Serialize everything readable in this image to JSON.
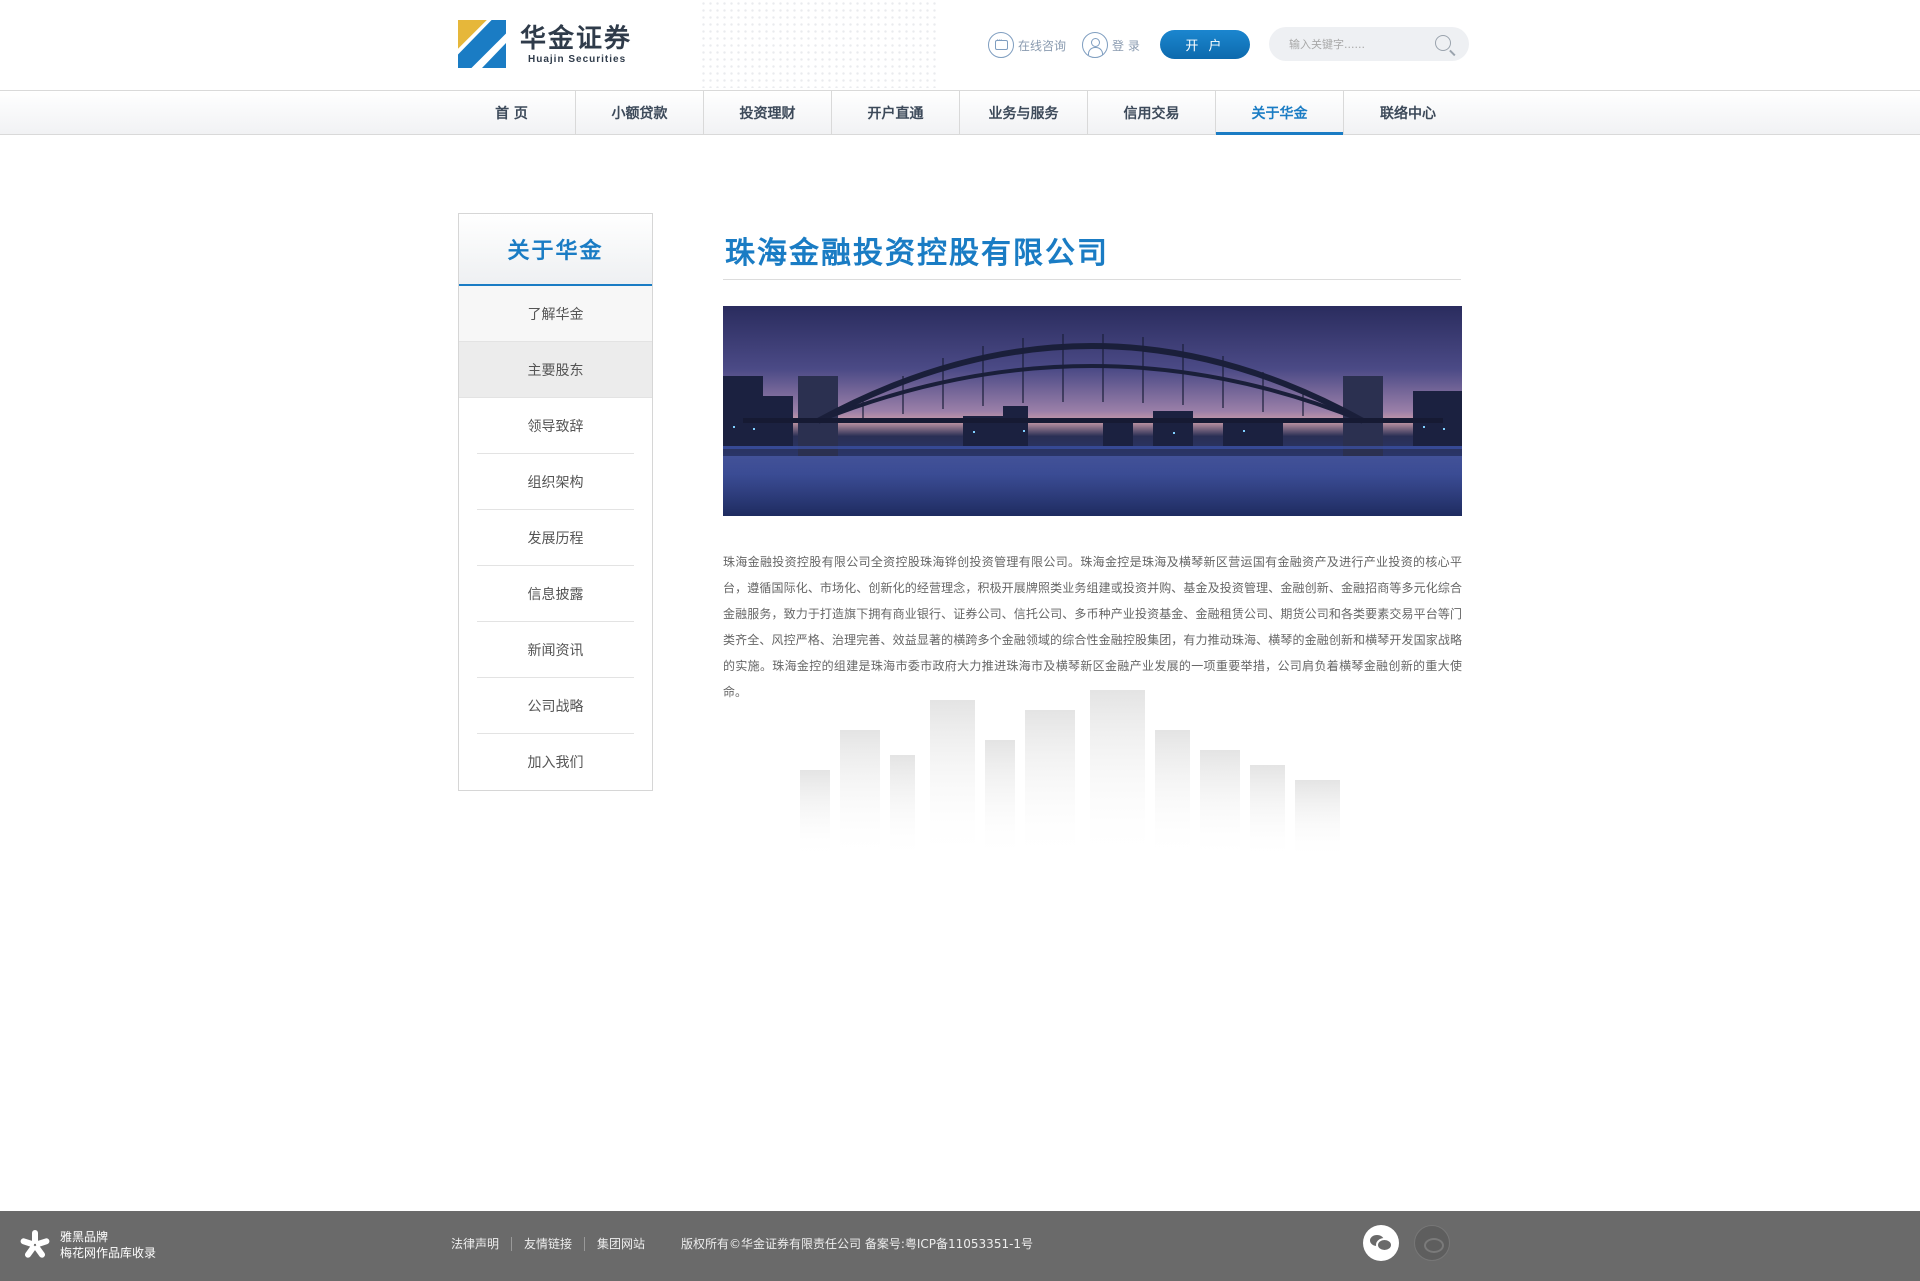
{
  "brand": {
    "name_cn": "华金证券",
    "name_en": "Huajin Securities"
  },
  "header": {
    "consult_label": "在线咨询",
    "login_label": "登 录",
    "open_account_label": "开 户",
    "search_placeholder": "输入关键字......"
  },
  "nav": {
    "items": [
      {
        "label": "首 页",
        "active": false
      },
      {
        "label": "小额贷款",
        "active": false
      },
      {
        "label": "投资理财",
        "active": false
      },
      {
        "label": "开户直通",
        "active": false
      },
      {
        "label": "业务与服务",
        "active": false
      },
      {
        "label": "信用交易",
        "active": false
      },
      {
        "label": "关于华金",
        "active": true
      },
      {
        "label": "联络中心",
        "active": false
      }
    ]
  },
  "sidebar": {
    "title": "关于华金",
    "items": [
      {
        "label": "了解华金"
      },
      {
        "label": "主要股东",
        "selected": true
      },
      {
        "label": "领导致辞"
      },
      {
        "label": "组织架构"
      },
      {
        "label": "发展历程"
      },
      {
        "label": "信息披露"
      },
      {
        "label": "新闻资讯"
      },
      {
        "label": "公司战略"
      },
      {
        "label": "加入我们"
      }
    ]
  },
  "main": {
    "title": "珠海金融投资控股有限公司",
    "image_icon": "harbour-bridge-night-photo",
    "body": "珠海金融投资控股有限公司全资控股珠海铧创投资管理有限公司。珠海金控是珠海及横琴新区营运国有金融资产及进行产业投资的核心平台，遵循国际化、市场化、创新化的经营理念，积极开展牌照类业务组建或投资并购、基金及投资管理、金融创新、金融招商等多元化综合金融服务，致力于打造旗下拥有商业银行、证券公司、信托公司、多币种产业投资基金、金融租赁公司、期货公司和各类要素交易平台等门类齐全、风控严格、治理完善、效益显著的横跨多个金融领域的综合性金融控股集团，有力推动珠海、横琴的金融创新和横琴开发国家战略的实施。珠海金控的组建是珠海市委市政府大力推进珠海市及横琴新区金融产业发展的一项重要举措，公司肩负着横琴金融创新的重大使命。"
  },
  "footer": {
    "brand_line1": "雅黑品牌",
    "brand_line2": "梅花网作品库收录",
    "links": [
      "法律声明",
      "友情链接",
      "集团网站"
    ],
    "copyright": "版权所有©华金证券有限责任公司    备案号:粤ICP备11053351-1号",
    "social_icons": [
      "wechat-icon",
      "weibo-icon"
    ]
  },
  "colors": {
    "accent": "#1a7cc4",
    "footer_bg": "#6a6a6a",
    "logo_yellow": "#e6b73a"
  }
}
